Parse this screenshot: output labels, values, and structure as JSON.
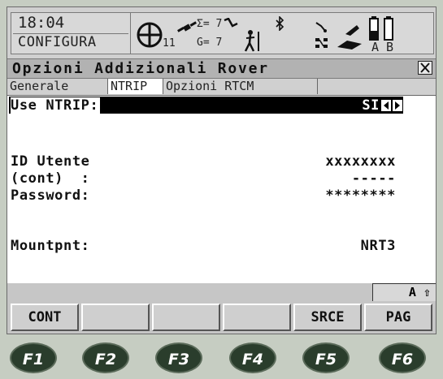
{
  "status": {
    "time": "18:04",
    "mode": "CONFIGURA",
    "sat_gps": "11",
    "sat_sigma": "Σ= 7",
    "sat_g": "G= 7",
    "battery_a": "A",
    "battery_b": "B"
  },
  "title": "Opzioni Addizionali Rover",
  "tabs": [
    "Generale",
    "NTRIP",
    "Opzioni RTCM"
  ],
  "active_tab": "NTRIP",
  "fields": {
    "use_ntrip_label": "Use NTRIP:",
    "use_ntrip_value": "SI",
    "user_id_label": "ID Utente",
    "user_id_value": "xxxxxxxx",
    "cont_label": "(cont)  :",
    "cont_value": "-----",
    "password_label": "Password:",
    "password_value": "********",
    "mountpoint_label": "Mountpnt:",
    "mountpoint_value": "NRT3"
  },
  "caps_indicator": "A ⇧",
  "softkeys": [
    "CONT",
    "",
    "",
    "",
    "SRCE",
    "PAG"
  ],
  "function_keys": [
    "F1",
    "F2",
    "F3",
    "F4",
    "F5",
    "F6"
  ],
  "colors": {
    "background": "#c6cdc2",
    "screen": "#ffffff",
    "fkey": "#2a3d2c"
  }
}
